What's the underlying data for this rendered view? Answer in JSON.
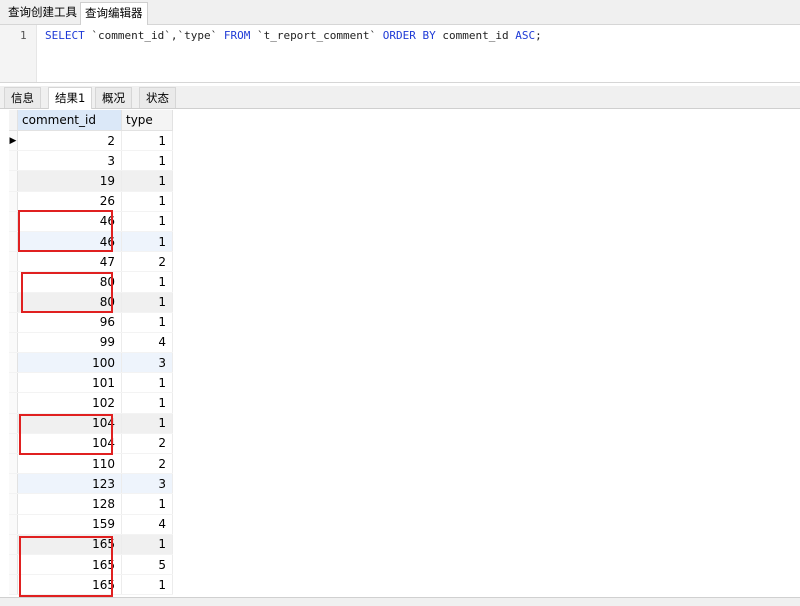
{
  "top_tabs": [
    "查询创建工具",
    "查询编辑器"
  ],
  "editor": {
    "line_number": "1",
    "sql_parts": {
      "select": "SELECT",
      "cols": " `comment_id`,`type` ",
      "from": "FROM",
      "table": " `t_report_comment` ",
      "order": "ORDER BY",
      "col": " comment_id ",
      "asc": "ASC",
      "end": ";"
    }
  },
  "result_tabs": [
    "信息",
    "结果1",
    "概况",
    "状态"
  ],
  "grid": {
    "columns": [
      "comment_id",
      "type"
    ],
    "rows": [
      [
        "2",
        "1"
      ],
      [
        "3",
        "1"
      ],
      [
        "19",
        "1"
      ],
      [
        "26",
        "1"
      ],
      [
        "46",
        "1"
      ],
      [
        "46",
        "1"
      ],
      [
        "47",
        "2"
      ],
      [
        "80",
        "1"
      ],
      [
        "80",
        "1"
      ],
      [
        "96",
        "1"
      ],
      [
        "99",
        "4"
      ],
      [
        "100",
        "3"
      ],
      [
        "101",
        "1"
      ],
      [
        "102",
        "1"
      ],
      [
        "104",
        "1"
      ],
      [
        "104",
        "2"
      ],
      [
        "110",
        "2"
      ],
      [
        "123",
        "3"
      ],
      [
        "128",
        "1"
      ],
      [
        "159",
        "4"
      ],
      [
        "165",
        "1"
      ],
      [
        "165",
        "5"
      ],
      [
        "165",
        "1"
      ]
    ],
    "current_row_marker": "▶"
  },
  "colors": {
    "accent_kw": "#1e3ad6",
    "highlight_box": "#e02020"
  }
}
